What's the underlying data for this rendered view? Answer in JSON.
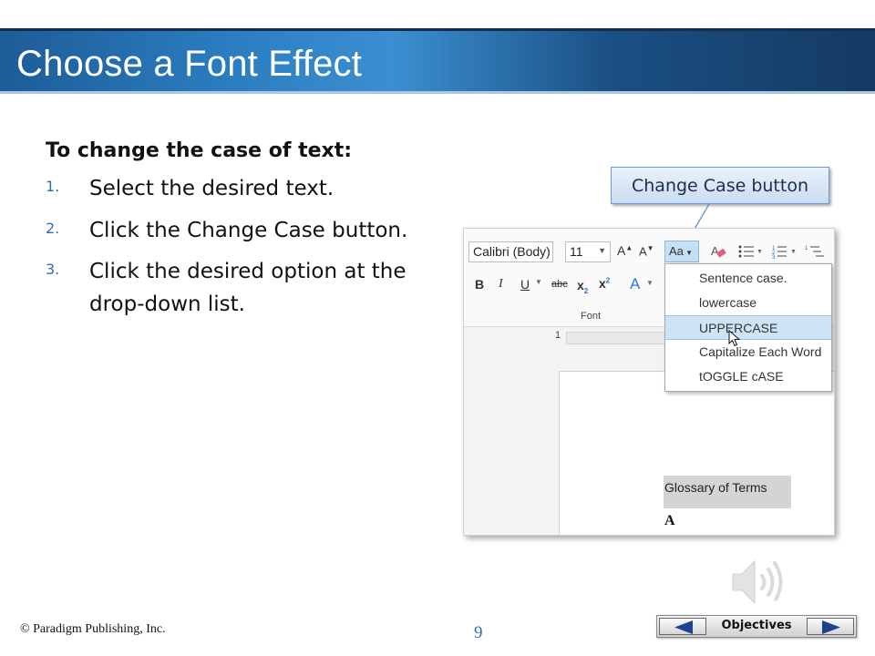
{
  "slide": {
    "title": "Choose a Font Effect",
    "heading": "To change the case of text:",
    "steps": [
      {
        "num": "1.",
        "text": "Select the desired text."
      },
      {
        "num": "2.",
        "text": "Click the Change Case button."
      },
      {
        "num": "3.",
        "text": "Click the desired option at the drop-down list."
      }
    ],
    "callout": "Change Case button"
  },
  "screenshot": {
    "font_name": "Calibri (Body)",
    "font_size": "11",
    "change_case_label": "Aa",
    "group_label": "Font",
    "ruler_number": "1",
    "menu_items": [
      "Sentence case.",
      "lowercase",
      "UPPERCASE",
      "Capitalize Each Word",
      "tOGGLE cASE"
    ],
    "selected_item": "UPPERCASE",
    "doc_heading": "Glossary of Terms",
    "doc_letter": "A"
  },
  "footer": {
    "copyright": "© Paradigm Publishing, Inc.",
    "page_number": "9",
    "nav_label": "Objectives"
  },
  "colors": {
    "accent": "#2a6ebb",
    "title_bar": "#1d5c97",
    "menu_highlight": "#cfe3f7"
  }
}
